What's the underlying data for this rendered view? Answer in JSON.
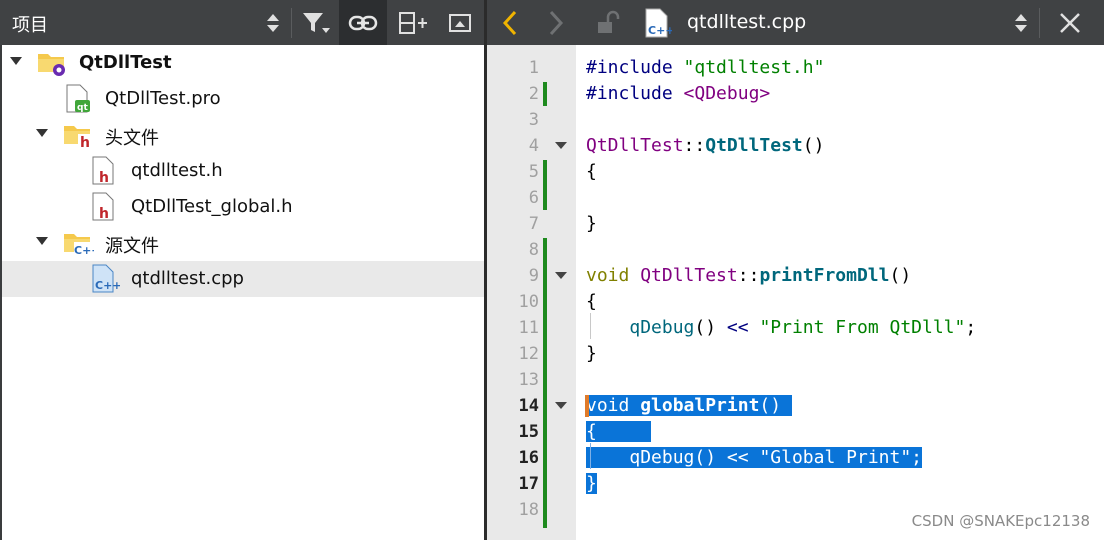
{
  "left_panel": {
    "title": "项目",
    "toolbar_icons": [
      "sort-updown-icon",
      "filter-icon",
      "link-icon",
      "split-add-icon",
      "maximize-icon"
    ]
  },
  "tree": [
    {
      "label": "QtDllTest",
      "icon": "project-folder-icon",
      "expanded": true,
      "bold": true
    },
    {
      "label": "QtDllTest.pro",
      "icon": "qt-pro-file-icon"
    },
    {
      "label": "头文件",
      "icon": "header-folder-icon",
      "expanded": true
    },
    {
      "label": "qtdlltest.h",
      "icon": "header-file-icon"
    },
    {
      "label": "QtDllTest_global.h",
      "icon": "header-file-icon"
    },
    {
      "label": "源文件",
      "icon": "source-folder-icon",
      "expanded": true
    },
    {
      "label": "qtdlltest.cpp",
      "icon": "cpp-file-icon",
      "selected": true
    }
  ],
  "editor": {
    "file_name": "qtdlltest.cpp",
    "current_line": "14",
    "line_numbers": [
      "1",
      "2",
      "3",
      "4",
      "5",
      "6",
      "7",
      "8",
      "9",
      "10",
      "11",
      "12",
      "13",
      "14",
      "15",
      "16",
      "17",
      "18"
    ],
    "code": {
      "l1_kw": "#include",
      "l1_str": "\"qtdlltest.h\"",
      "l2_kw": "#include",
      "l2_inc": "<QDebug>",
      "l4_cls": "QtDllTest",
      "l4_sep": "::",
      "l4_fn": "QtDllTest",
      "l4_paren": "()",
      "l5": "{",
      "l7": "}",
      "l9_kw": "void",
      "l9_cls": "QtDllTest",
      "l9_sep": "::",
      "l9_fn": "printFromDll",
      "l9_paren": "()",
      "l10": "{",
      "l11_call": "qDebug",
      "l11_paren": "()",
      "l11_op": "<<",
      "l11_str": "\"Print From QtDlll\"",
      "l11_end": ";",
      "l12": "}",
      "l14_kw": "void",
      "l14_fn": "globalPrint",
      "l14_paren": "()",
      "l15": "{",
      "l16_call": "qDebug",
      "l16_paren": "()",
      "l16_op": "<<",
      "l16_str": "\"Global Print\"",
      "l16_end": ";",
      "l17": "}"
    }
  },
  "watermark": "CSDN @SNAKEpc12138",
  "colors": {
    "toolbar_bg": "#404244",
    "selection": "#0a74d8",
    "change_bar": "#1e8a1e",
    "back_arrow": "#f0b400"
  }
}
